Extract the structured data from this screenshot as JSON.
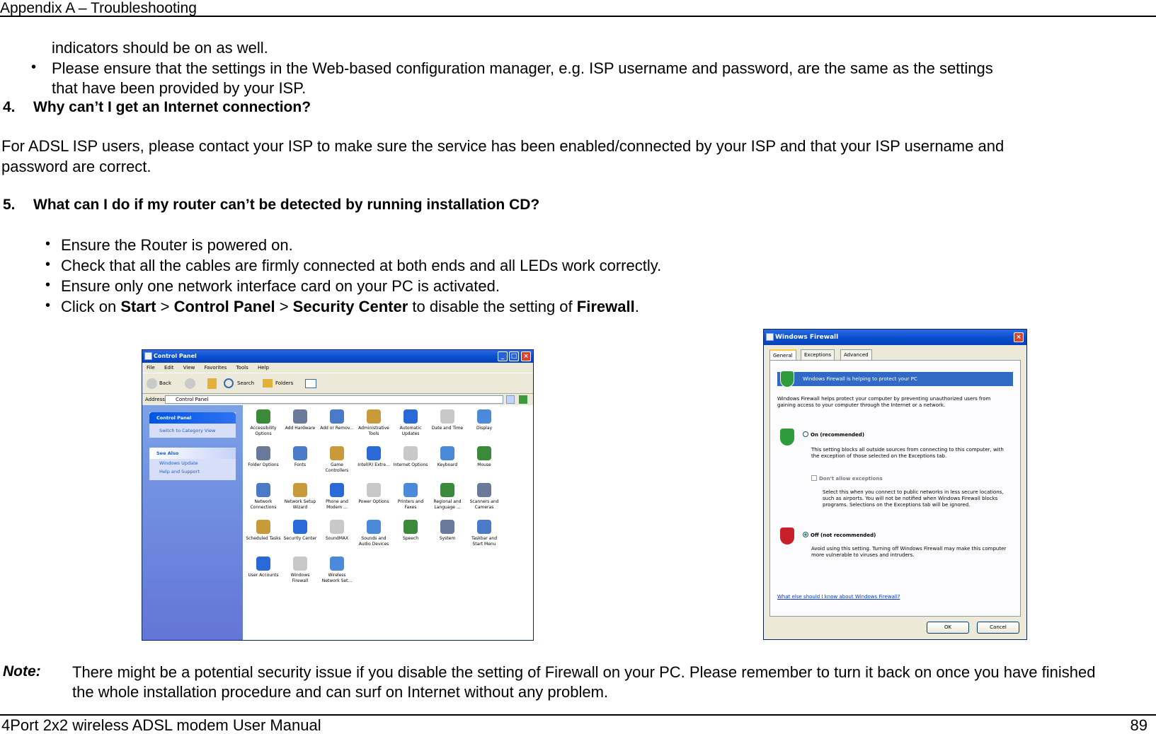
{
  "header": {
    "title": "Appendix A – Troubleshooting"
  },
  "content": {
    "line_cont_1": "indicators should be on as well.",
    "bullet_ensure_settings_1": "Please ensure that the settings in the Web-based configuration manager, e.g. ISP username and password, are the same as the settings",
    "bullet_ensure_settings_2": "that have been provided by your ISP.",
    "q4_number": "4.",
    "q4_text": "Why can’t I get an Internet connection?",
    "q4_answer_1": "For ADSL ISP users, please contact your ISP to make sure the service has been enabled/connected by your ISP and that your ISP username and",
    "q4_answer_2": "password are correct.",
    "q5_number": "5.",
    "q5_text": "What can I do if my router can’t be detected by running installation CD?",
    "bullets": [
      "Ensure the Router is powered on.",
      "Check that all the cables are firmly connected at both ends and all LEDs work correctly.",
      "Ensure only one network interface card on your PC is activated."
    ],
    "click_prefix": "Click on ",
    "click_start": "Start",
    "click_sep1": " > ",
    "click_control_panel": "Control Panel",
    "click_sep2": " > ",
    "click_security_center": "Security Center",
    "click_mid": " to disable the setting of ",
    "click_firewall": "Firewall",
    "click_end": ".",
    "note_label": "Note:",
    "note_line_1": "There might be a potential security issue if you disable the setting of Firewall on your PC. Please remember to turn it back on once you have finished",
    "note_line_2": "the whole installation procedure and can surf on Internet without any problem."
  },
  "control_panel": {
    "title": "Control Panel",
    "menu": [
      "File",
      "Edit",
      "View",
      "Favorites",
      "Tools",
      "Help"
    ],
    "toolbar": {
      "back": "Back",
      "search": "Search",
      "folders": "Folders"
    },
    "address_label": "Address",
    "address_value": "Control Panel",
    "go": "Go",
    "side_panel_title": "Control Panel",
    "switch_view": "Switch to Category View",
    "see_also": "See Also",
    "see_also_items": [
      "Windows Update",
      "Help and Support"
    ],
    "icons": [
      "Accessibility Options",
      "Add Hardware",
      "Add or Remov...",
      "Administrative Tools",
      "Automatic Updates",
      "Date and Time",
      "Display",
      "Folder Options",
      "Fonts",
      "Game Controllers",
      "Intel(R) Extre...",
      "Internet Options",
      "Keyboard",
      "Mouse",
      "Network Connections",
      "Network Setup Wizard",
      "Phone and Modem ...",
      "Power Options",
      "Printers and Faxes",
      "Regional and Language ...",
      "Scanners and Cameras",
      "Scheduled Tasks",
      "Security Center",
      "SoundMAX",
      "Sounds and Audio Devices",
      "Speech",
      "System",
      "Taskbar and Start Menu",
      "User Accounts",
      "Windows Firewall",
      "Wireless Network Set..."
    ],
    "icon_colors": [
      "#3a8a3a",
      "#6a7a9a",
      "#4a7ac8",
      "#c89a3a",
      "#2a6ad8",
      "#c8c8c8",
      "#4a8ad8"
    ]
  },
  "firewall": {
    "title": "Windows Firewall",
    "tabs": [
      "General",
      "Exceptions",
      "Advanced"
    ],
    "banner": "Windows Firewall is helping to protect your PC",
    "intro": "Windows Firewall helps protect your computer by preventing unauthorized users from gaining access to your computer through the Internet or a network.",
    "on_label": "On (recommended)",
    "on_desc": "This setting blocks all outside sources from connecting to this computer, with the exception of those selected on the Exceptions tab.",
    "no_exceptions_label": "Don't allow exceptions",
    "no_exceptions_desc": "Select this when you connect to public networks in less secure locations, such as airports. You will not be notified when Windows Firewall blocks programs. Selections on the Exceptions tab will be ignored.",
    "off_label": "Off (not recommended)",
    "off_desc": "Avoid using this setting. Turning off Windows Firewall may make this computer more vulnerable to viruses and intruders.",
    "help_link": "What else should I know about Windows Firewall?",
    "ok": "OK",
    "cancel": "Cancel"
  },
  "footer": {
    "manual_title": "4Port 2x2 wireless ADSL modem User Manual",
    "page_number": "89"
  }
}
